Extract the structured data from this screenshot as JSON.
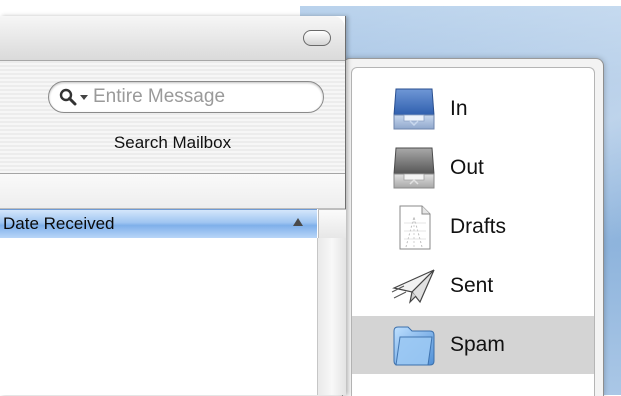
{
  "drawer": {
    "search": {
      "placeholder": "Entire Message",
      "caption": "Search Mailbox"
    },
    "column_header": {
      "label": "Date Received",
      "sort_direction": "ascending"
    }
  },
  "mailboxes": [
    {
      "label": "In",
      "icon": "inbox-tray-icon",
      "selected": false
    },
    {
      "label": "Out",
      "icon": "outbox-tray-icon",
      "selected": false
    },
    {
      "label": "Drafts",
      "icon": "drafts-document-icon",
      "selected": false
    },
    {
      "label": "Sent",
      "icon": "paper-plane-icon",
      "selected": false
    },
    {
      "label": "Spam",
      "icon": "folder-icon",
      "selected": true
    }
  ],
  "colors": {
    "selection_gray": "#d4d4d4",
    "header_blue": "#9fc5f1",
    "desktop_blue": "#8db3dc"
  }
}
